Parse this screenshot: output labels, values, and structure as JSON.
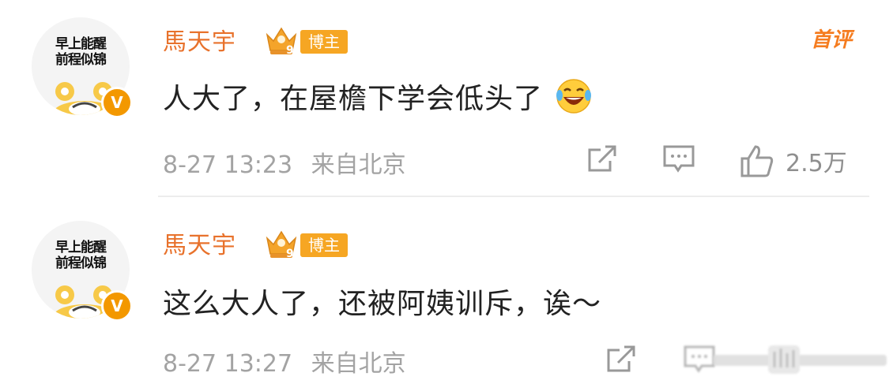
{
  "comments": [
    {
      "avatar_text_line1": "早上能醒",
      "avatar_text_line2": "前程似锦",
      "verified_mark": "V",
      "username": "馬天宇",
      "level_icon": "crown-level-9-icon",
      "level_number": "9",
      "tag": "博主",
      "first_badge": "首评",
      "content": "人大了，在屋檐下学会低头了",
      "content_emoji": "laughing-tears-emoji",
      "time": "8-27 13:23",
      "source": "来自北京",
      "like_count": "2.5万"
    },
    {
      "avatar_text_line1": "早上能醒",
      "avatar_text_line2": "前程似锦",
      "verified_mark": "V",
      "username": "馬天宇",
      "level_icon": "crown-level-9-icon",
      "level_number": "9",
      "tag": "博主",
      "content": "这么大人了，还被阿姨训斥，诶～",
      "time": "8-27 13:27",
      "source": "来自北京"
    }
  ],
  "colors": {
    "username": "#e8722c",
    "tag_bg": "#f6a623",
    "first_badge": "#f57c1f",
    "meta_text": "#a3a3a3",
    "verified_badge": "#f39800"
  }
}
